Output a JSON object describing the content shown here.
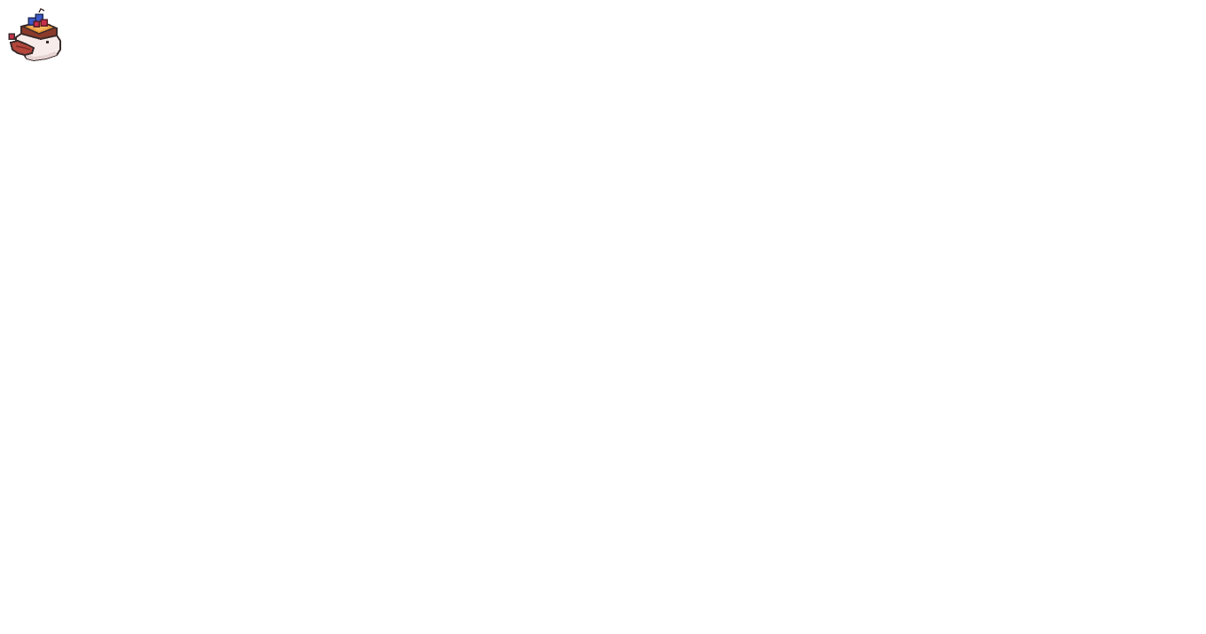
{
  "page": {
    "background": "#ffffff"
  },
  "mascot": {
    "icon": "pixel-toast-creature-icon",
    "colors": {
      "body": "#f7ecea",
      "outline": "#3a2a2a",
      "crust": "#8a3a2a",
      "topping": "#e8963a",
      "berry_blue": "#3a5ac8",
      "berry_red": "#c8304a",
      "tongue": "#b4463c"
    }
  }
}
